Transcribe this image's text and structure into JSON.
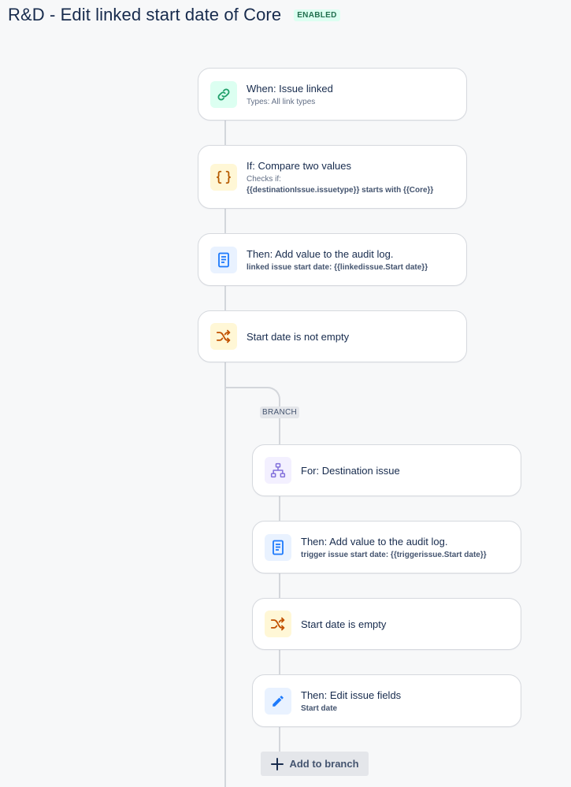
{
  "header": {
    "title": "R&D - Edit linked start date of Core",
    "status_badge": "ENABLED"
  },
  "steps": [
    {
      "icon": "link-icon",
      "title": "When: Issue linked",
      "subtitle": "Types: All link types"
    },
    {
      "icon": "curly-braces-icon",
      "title": "If: Compare two values",
      "subtitle": "Checks if:",
      "detail": "{{destinationIssue.issuetype}} starts with {{Core}}"
    },
    {
      "icon": "document-icon",
      "title": "Then: Add value to the audit log.",
      "detail": "linked issue start date: {{linkedissue.Start date}}"
    },
    {
      "icon": "shuffle-icon",
      "title": "Start date is not empty"
    }
  ],
  "branch": {
    "tag": "BRANCH",
    "steps": [
      {
        "icon": "hierarchy-icon",
        "title": "For: Destination issue"
      },
      {
        "icon": "document-icon",
        "title": "Then: Add value to the audit log.",
        "detail": "trigger issue start date: {{triggerissue.Start date}}"
      },
      {
        "icon": "shuffle-icon",
        "title": "Start date is empty"
      },
      {
        "icon": "pencil-icon",
        "title": "Then: Edit issue fields",
        "detail": "Start date"
      }
    ],
    "add_label": "Add to branch"
  },
  "colors": {
    "link": "#22a06b",
    "braces": "#b65c02",
    "document": "#1d7afc",
    "shuffle": "#c25100",
    "hierarchy": "#8270db",
    "pencil": "#1d7afc",
    "enabled": "#216e4e"
  }
}
